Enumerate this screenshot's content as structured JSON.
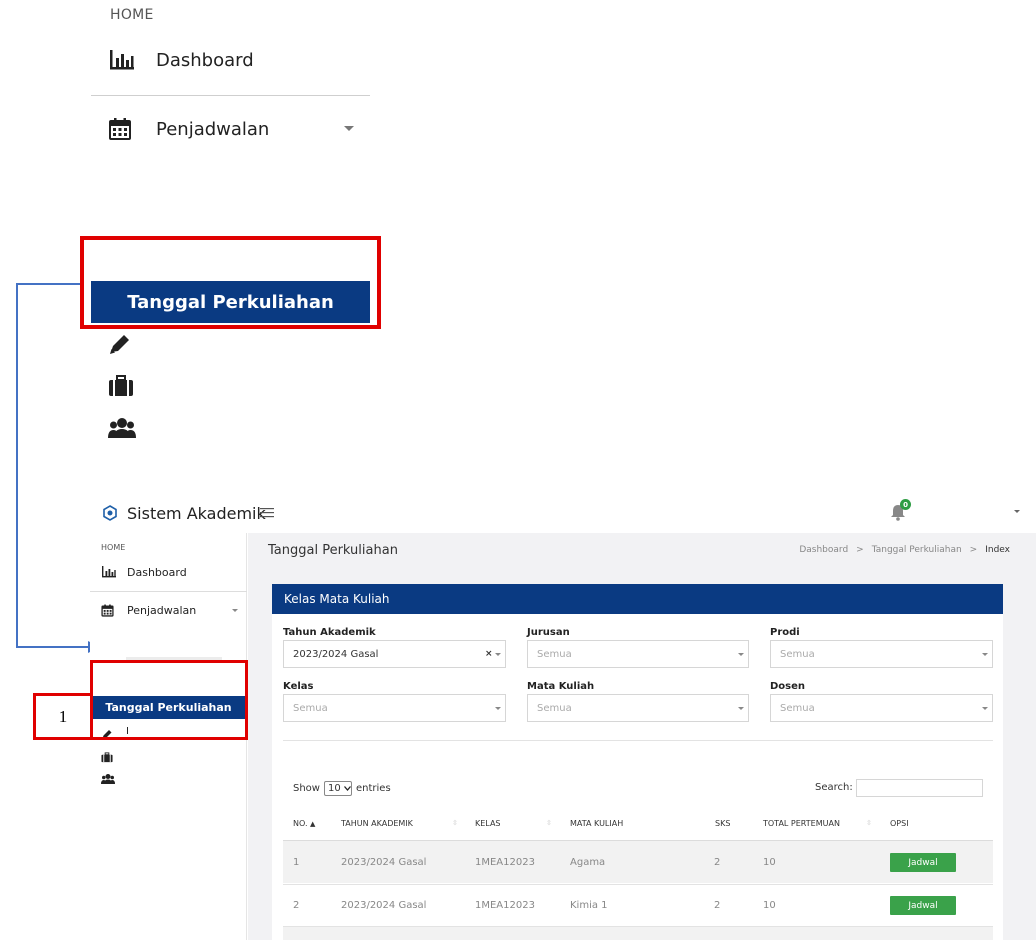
{
  "zoom_sidebar": {
    "section_heading": "HOME",
    "dashboard_label": "Dashboard",
    "penjadwalan_label": "Penjadwalan",
    "active_label": "Tanggal Perkuliahan"
  },
  "app": {
    "brand": "Sistem Akademik",
    "notification_count": "0"
  },
  "sidebar": {
    "section_heading": "HOME",
    "dashboard_label": "Dashboard",
    "penjadwalan_label": "Penjadwalan",
    "active_label": "Tanggal Perkuliahan",
    "partial_item_label": "I"
  },
  "annotation": {
    "step_number": "1",
    "highlight_color": "#e00000",
    "connector_color": "#4472c4"
  },
  "page": {
    "title": "Tanggal Perkuliahan",
    "breadcrumb": [
      "Dashboard",
      "Tanggal Perkuliahan",
      "Index"
    ],
    "breadcrumb_separator": ">"
  },
  "card": {
    "title": "Kelas Mata Kuliah",
    "header_color": "#0a3a82"
  },
  "filters": {
    "tahun_akademik": {
      "label": "Tahun Akademik",
      "value": "2023/2024 Gasal"
    },
    "jurusan": {
      "label": "Jurusan",
      "value": "Semua"
    },
    "prodi": {
      "label": "Prodi",
      "value": "Semua"
    },
    "kelas": {
      "label": "Kelas",
      "value": "Semua"
    },
    "mata_kuliah": {
      "label": "Mata Kuliah",
      "value": "Semua"
    },
    "dosen": {
      "label": "Dosen",
      "value": "Semua"
    }
  },
  "table_controls": {
    "show_label": "Show",
    "entries_value": "10",
    "entries_label": "entries",
    "search_label": "Search:"
  },
  "table": {
    "columns": [
      "NO.",
      "TAHUN AKADEMIK",
      "KELAS",
      "MATA KULIAH",
      "SKS",
      "TOTAL PERTEMUAN",
      "OPSI"
    ],
    "rows": [
      {
        "no": "1",
        "tahun": "2023/2024 Gasal",
        "kelas": "1MEA12023",
        "matkul": "Agama",
        "sks": "2",
        "total": "10",
        "opsi": "Jadwal"
      },
      {
        "no": "2",
        "tahun": "2023/2024 Gasal",
        "kelas": "1MEA12023",
        "matkul": "Kimia 1",
        "sks": "2",
        "total": "10",
        "opsi": "Jadwal"
      }
    ]
  },
  "colors": {
    "primary": "#0a3a82",
    "success_button": "#3aa24a",
    "badge": "#2e9d44"
  }
}
